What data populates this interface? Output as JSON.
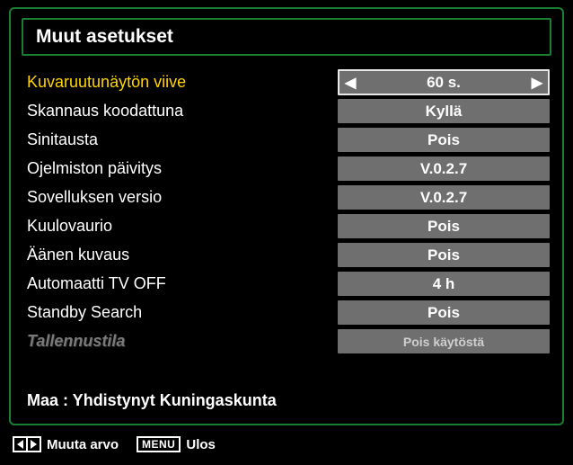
{
  "title": "Muut asetukset",
  "settings": [
    {
      "label": "Kuvaruutunäytön viive",
      "value": "60 s.",
      "selected": true
    },
    {
      "label": "Skannaus koodattuna",
      "value": "Kyllä"
    },
    {
      "label": "Sinitausta",
      "value": "Pois"
    },
    {
      "label": "Ojelmiston päivitys",
      "value": "V.0.2.7"
    },
    {
      "label": "Sovelluksen versio",
      "value": "V.0.2.7"
    },
    {
      "label": "Kuulovaurio",
      "value": "Pois"
    },
    {
      "label": "Äänen kuvaus",
      "value": "Pois"
    },
    {
      "label": "Automaatti TV OFF",
      "value": "4 h"
    },
    {
      "label": "Standby Search",
      "value": "Pois"
    },
    {
      "label": "Tallennustila",
      "value": "Pois käytöstä",
      "disabled": true
    }
  ],
  "country_line": "Maa : Yhdistynyt Kuningaskunta",
  "hints": {
    "change_value": "Muuta arvo",
    "menu_label": "MENU",
    "menu_action": "Ulos"
  }
}
